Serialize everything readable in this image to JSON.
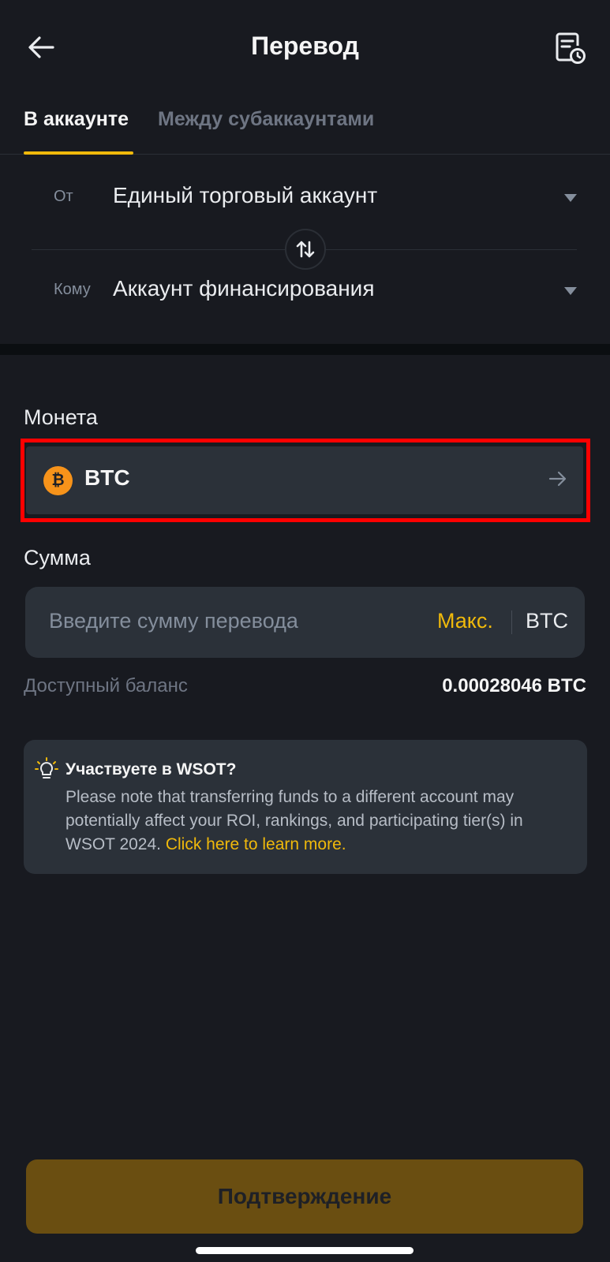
{
  "header": {
    "title": "Перевод"
  },
  "tabs": [
    {
      "label": "В аккаунте",
      "active": true
    },
    {
      "label": "Между субаккаунтами",
      "active": false
    }
  ],
  "transfer": {
    "from_label": "От",
    "from_value": "Единый торговый аккаунт",
    "to_label": "Кому",
    "to_value": "Аккаунт финансирования"
  },
  "coin": {
    "section_label": "Монета",
    "symbol": "BTC",
    "icon_glyph": "₿"
  },
  "amount": {
    "section_label": "Сумма",
    "placeholder": "Введите сумму перевода",
    "max_label": "Макс.",
    "unit": "BTC",
    "balance_label": "Доступный баланс",
    "balance_value": "0.00028046 BTC"
  },
  "notice": {
    "title": "Участвуете в WSOT?",
    "text": "Please note that transferring funds to a different account may potentially affect your ROI, rankings, and participating tier(s) in WSOT 2024.",
    "link": "Click here to learn more."
  },
  "confirm": {
    "label": "Подтверждение"
  },
  "colors": {
    "accent": "#f0b90b",
    "background": "#181a20",
    "highlight": "#ff0000"
  }
}
